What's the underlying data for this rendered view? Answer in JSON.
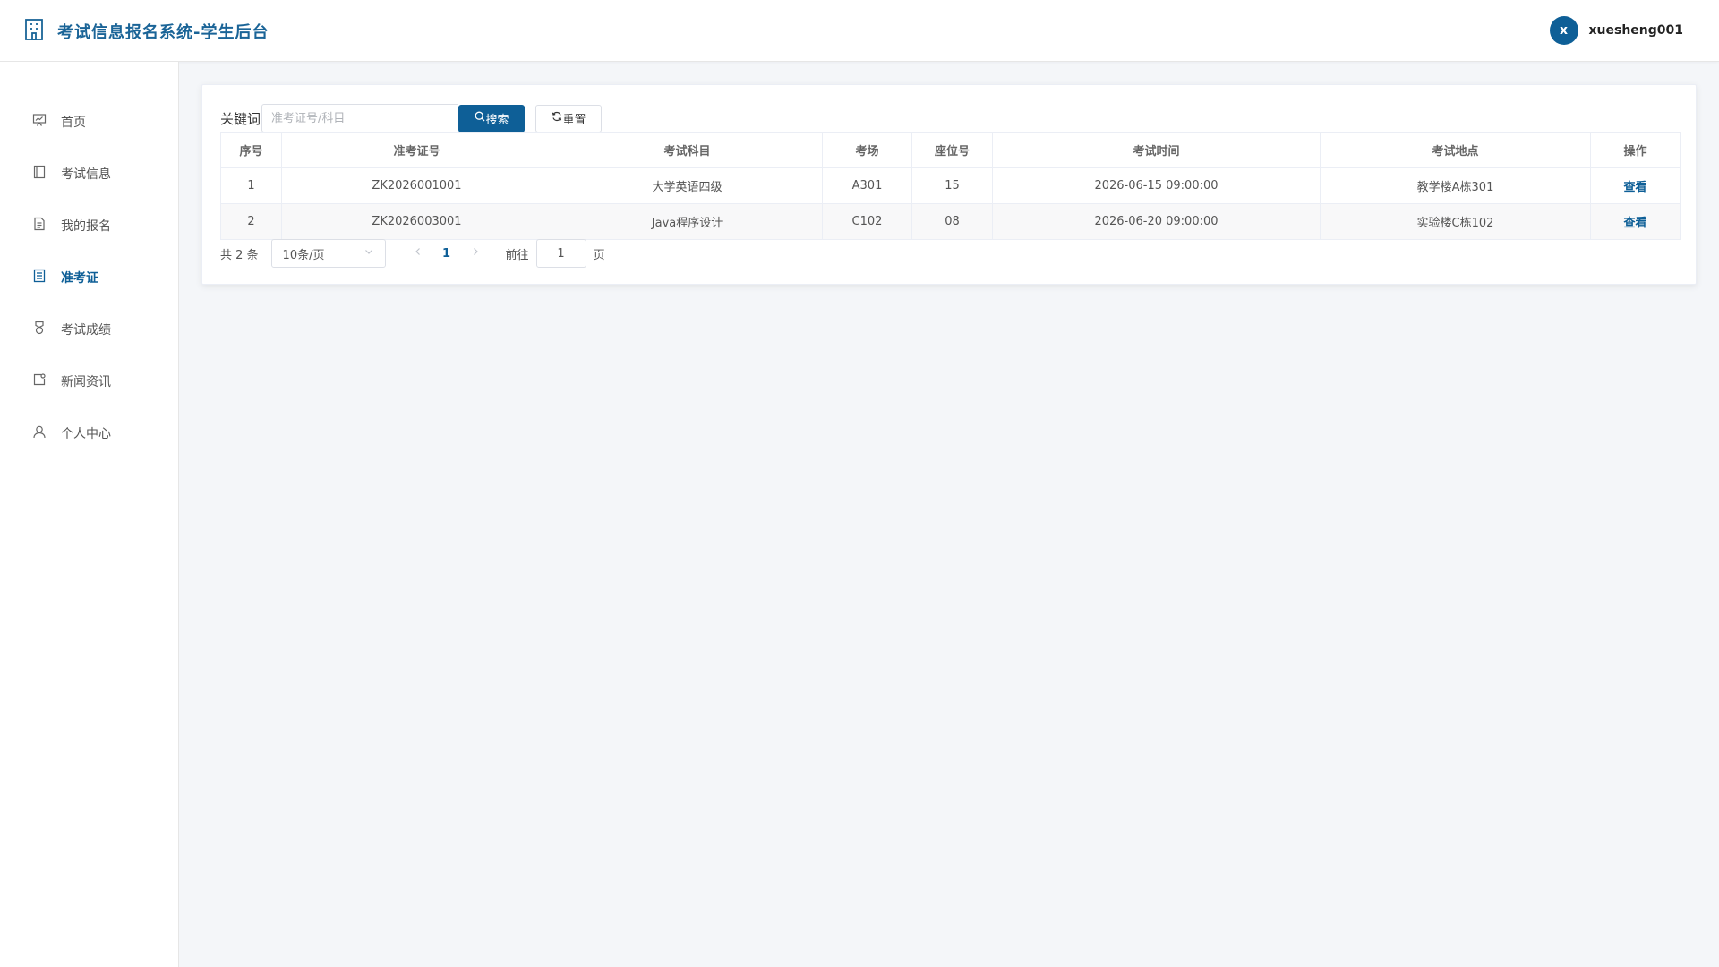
{
  "header": {
    "title": "考试信息报名系统-学生后台",
    "avatar_letter": "x",
    "username": "xuesheng001"
  },
  "sidebar": {
    "items": [
      {
        "label": "首页",
        "icon": "presentation-icon"
      },
      {
        "label": "考试信息",
        "icon": "book-icon"
      },
      {
        "label": "我的报名",
        "icon": "document-icon"
      },
      {
        "label": "准考证",
        "icon": "ticket-icon",
        "active": true
      },
      {
        "label": "考试成绩",
        "icon": "medal-icon"
      },
      {
        "label": "新闻资讯",
        "icon": "news-icon"
      },
      {
        "label": "个人中心",
        "icon": "user-icon"
      }
    ]
  },
  "search": {
    "label": "关键词",
    "placeholder": "准考证号/科目",
    "value": "",
    "search_label": "搜索",
    "reset_label": "重置"
  },
  "table": {
    "columns": [
      "序号",
      "准考证号",
      "考试科目",
      "考场",
      "座位号",
      "考试时间",
      "考试地点",
      "操作"
    ],
    "rows": [
      {
        "index": "1",
        "ticket_no": "ZK2026001001",
        "subject": "大学英语四级",
        "room": "A301",
        "seat": "15",
        "time": "2026-06-15 09:00:00",
        "location": "教学楼A栋301",
        "action": "查看"
      },
      {
        "index": "2",
        "ticket_no": "ZK2026003001",
        "subject": "Java程序设计",
        "room": "C102",
        "seat": "08",
        "time": "2026-06-20 09:00:00",
        "location": "实验楼C栋102",
        "action": "查看"
      }
    ]
  },
  "pagination": {
    "total_text": "共 2 条",
    "page_size": "10条/页",
    "current_page": "1",
    "goto_label": "前往",
    "goto_value": "1",
    "goto_suffix": "页"
  },
  "colors": {
    "accent": "#0e5f97",
    "title": "#1a6497",
    "background": "#f4f6f9"
  }
}
